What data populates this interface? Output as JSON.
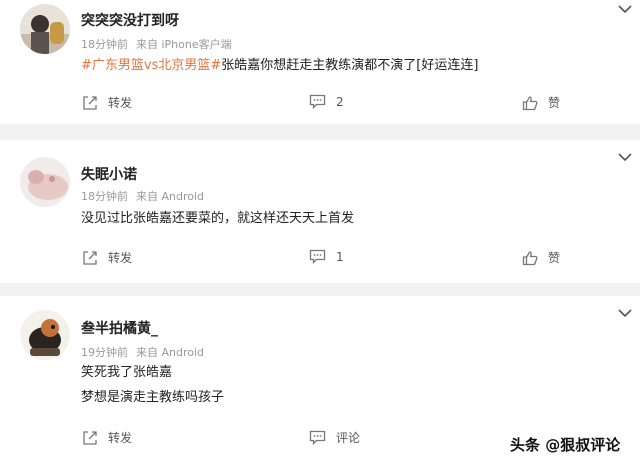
{
  "posts": [
    {
      "username": "突突突没打到呀",
      "time": "18分钟前",
      "source": "来自 iPhone客户端",
      "tag1": "#广东男篮vs北京男篮#",
      "body": "张皓嘉你想赶走主教练演都不演了[好运连连]",
      "repost_label": "转发",
      "comment_label": "2",
      "like_label": "赞"
    },
    {
      "username": "失眠小诺",
      "time": "18分钟前",
      "source": "来自 Android",
      "body": "没见过比张皓嘉还要菜的，就这样还天天上首发",
      "repost_label": "转发",
      "comment_label": "1",
      "like_label": "赞"
    },
    {
      "username": "叁半拍橘黄_",
      "time": "19分钟前",
      "source": "来自 Android",
      "body_line1": "笑死我了张皓嘉",
      "body_line2": "梦想是演走主教练吗孩子",
      "repost_label": "转发",
      "comment_label": "评论",
      "like_label": "赞"
    }
  ],
  "watermark": "头条 @狠叔评论",
  "colors": {
    "tag": "#eb7340",
    "text": "#222222",
    "meta": "#999999",
    "bg": "#f2f2f2"
  },
  "icons": [
    "chevron-down-icon",
    "repost-icon",
    "comment-icon",
    "like-icon"
  ]
}
